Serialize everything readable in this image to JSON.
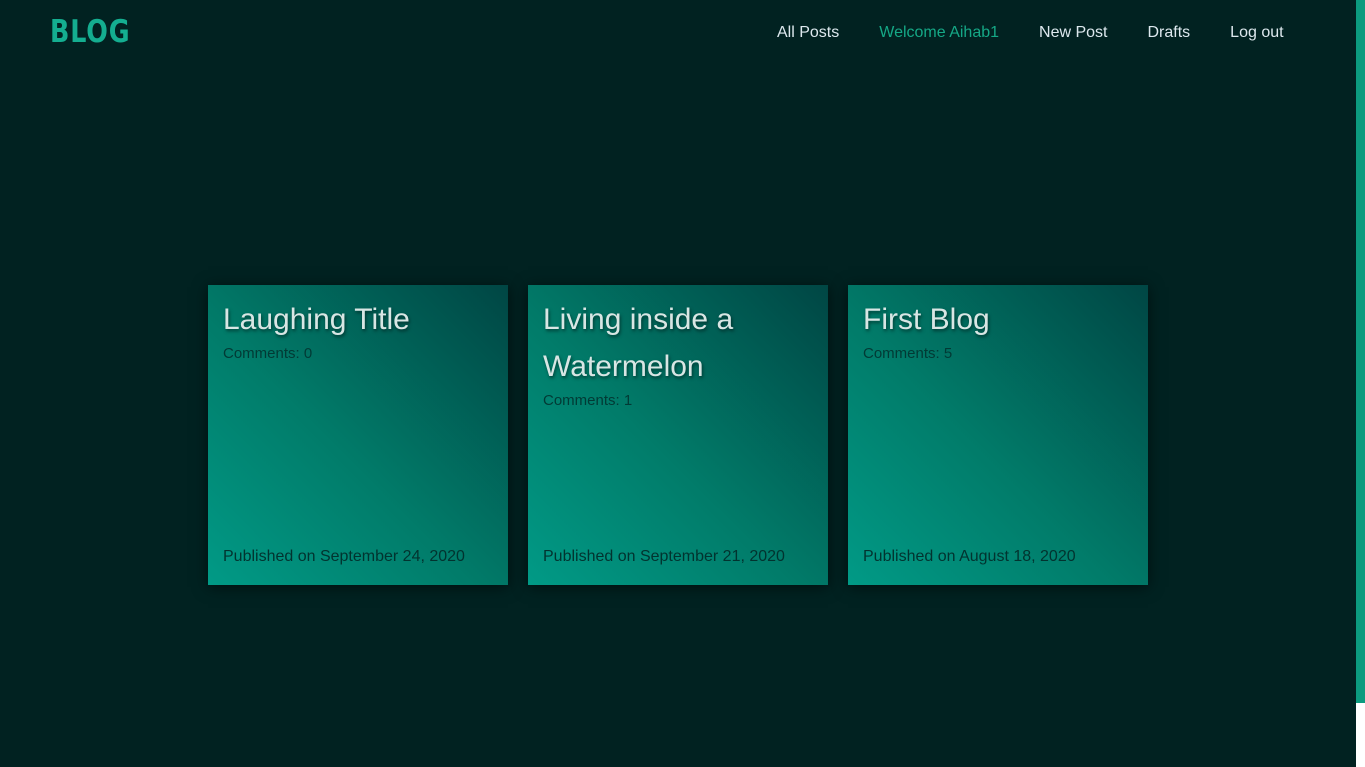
{
  "logo": "BLOG",
  "nav": {
    "all_posts": "All Posts",
    "welcome": "Welcome Aihab1",
    "new_post": "New Post",
    "drafts": "Drafts",
    "log_out": "Log out"
  },
  "posts": [
    {
      "title": "Laughing Title",
      "comments": "Comments: 0",
      "published": "Published on September 24, 2020"
    },
    {
      "title": "Living inside a Watermelon",
      "comments": "Comments: 1",
      "published": "Published on September 21, 2020"
    },
    {
      "title": "First Blog",
      "comments": "Comments: 5",
      "published": "Published on August 18, 2020"
    }
  ],
  "colors": {
    "background": "#012221",
    "accent": "#14ae90",
    "nav_text": "#dde8ee"
  }
}
